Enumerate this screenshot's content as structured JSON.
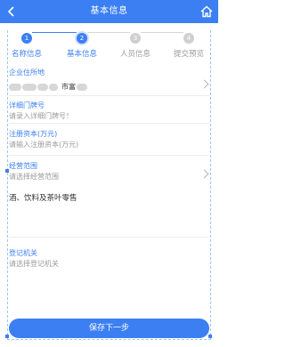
{
  "header": {
    "title": "基本信息"
  },
  "steps": [
    {
      "number": "1",
      "label": "名称信息",
      "state": "done"
    },
    {
      "number": "2",
      "label": "基本信息",
      "state": "active"
    },
    {
      "number": "3",
      "label": "人员信息",
      "state": "todo"
    },
    {
      "number": "4",
      "label": "提交预览",
      "state": "todo"
    }
  ],
  "form": {
    "address": {
      "label": "企业住所地",
      "value_visible": "市富"
    },
    "house_number": {
      "label": "详细门牌号",
      "placeholder": "请录入详细门牌号！"
    },
    "capital": {
      "label": "注册资本(万元)",
      "placeholder": "请输入注册资本(万元)"
    },
    "scope": {
      "label": "经营范围",
      "placeholder": "请选择经营范围",
      "value": "酒、饮料及茶叶零售"
    },
    "authority": {
      "label": "登记机关",
      "placeholder": "请选择登记机关"
    }
  },
  "actions": {
    "save_next": "保存下一步"
  },
  "colors": {
    "primary": "#3b7ff2",
    "inactive": "#cfcfcf",
    "text": "#333333",
    "placeholder": "#9a9a9a"
  }
}
